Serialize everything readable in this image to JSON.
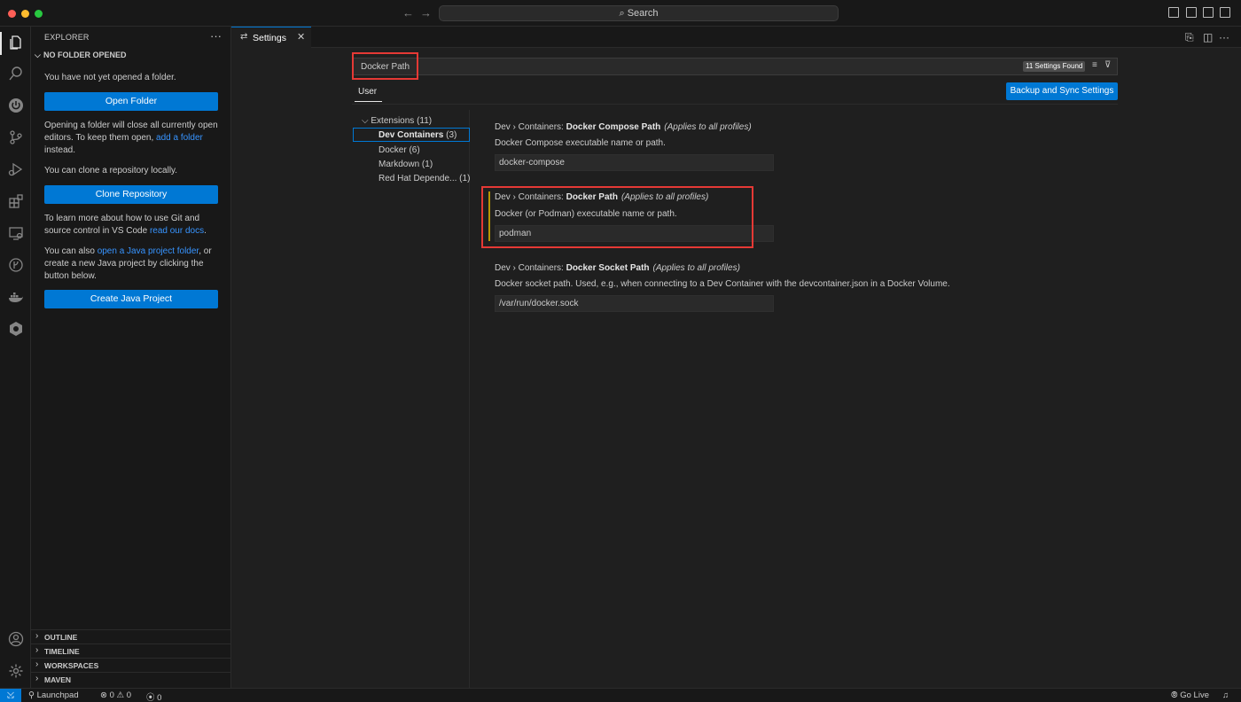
{
  "titlebar": {
    "search_label": "Search"
  },
  "sidebar": {
    "title": "EXPLORER",
    "section_title": "NO FOLDER OPENED",
    "no_folder_text": "You have not yet opened a folder.",
    "open_folder_label": "Open Folder",
    "warning_text_1": "Opening a folder will close all currently open editors. To keep them open,",
    "warning_link": "add a folder",
    "warning_text_2": "instead.",
    "clone_text": "You can clone a repository locally.",
    "clone_label": "Clone Repository",
    "git_text": "To learn more about how to use Git and source control in VS Code",
    "git_link": "read our docs",
    "java_text_1": "You can also",
    "java_link": "open a Java project folder",
    "java_text_2": ", or create a new Java project by clicking the button below.",
    "java_label": "Create Java Project",
    "bottom_sections": [
      "OUTLINE",
      "TIMELINE",
      "WORKSPACES",
      "MAVEN"
    ]
  },
  "tab": {
    "label": "Settings"
  },
  "settings": {
    "search_value": "Docker Path",
    "found_badge": "11 Settings Found",
    "scope_tab": "User",
    "sync_label": "Backup and Sync Settings",
    "toc": {
      "extensions": "Extensions (11)",
      "items": [
        {
          "label": "Dev Containers",
          "count": "(3)"
        },
        {
          "label": "Docker",
          "count": "(6)"
        },
        {
          "label": "Markdown",
          "count": "(1)"
        },
        {
          "label": "Red Hat Depende...",
          "count": "(1)"
        }
      ]
    },
    "items": [
      {
        "prefix": "Dev › Containers: ",
        "name": "Docker Compose Path",
        "scope": "(Applies to all profiles)",
        "description": "Docker Compose executable name or path.",
        "value": "docker-compose"
      },
      {
        "prefix": "Dev › Containers: ",
        "name": "Docker Path",
        "scope": "(Applies to all profiles)",
        "description": "Docker (or Podman) executable name or path.",
        "value": "podman"
      },
      {
        "prefix": "Dev › Containers: ",
        "name": "Docker Socket Path",
        "scope": "(Applies to all profiles)",
        "description": "Docker socket path. Used, e.g., when connecting to a Dev Container with the devcontainer.json in a Docker Volume.",
        "value": "/var/run/docker.sock"
      }
    ]
  },
  "statusbar": {
    "launchpad": "Launchpad",
    "errors": "0",
    "warnings": "0",
    "ports": "0",
    "go_live": "Go Live"
  },
  "colors": {
    "accent": "#0078d4",
    "highlight": "#e53935",
    "modified": "#b89500"
  }
}
